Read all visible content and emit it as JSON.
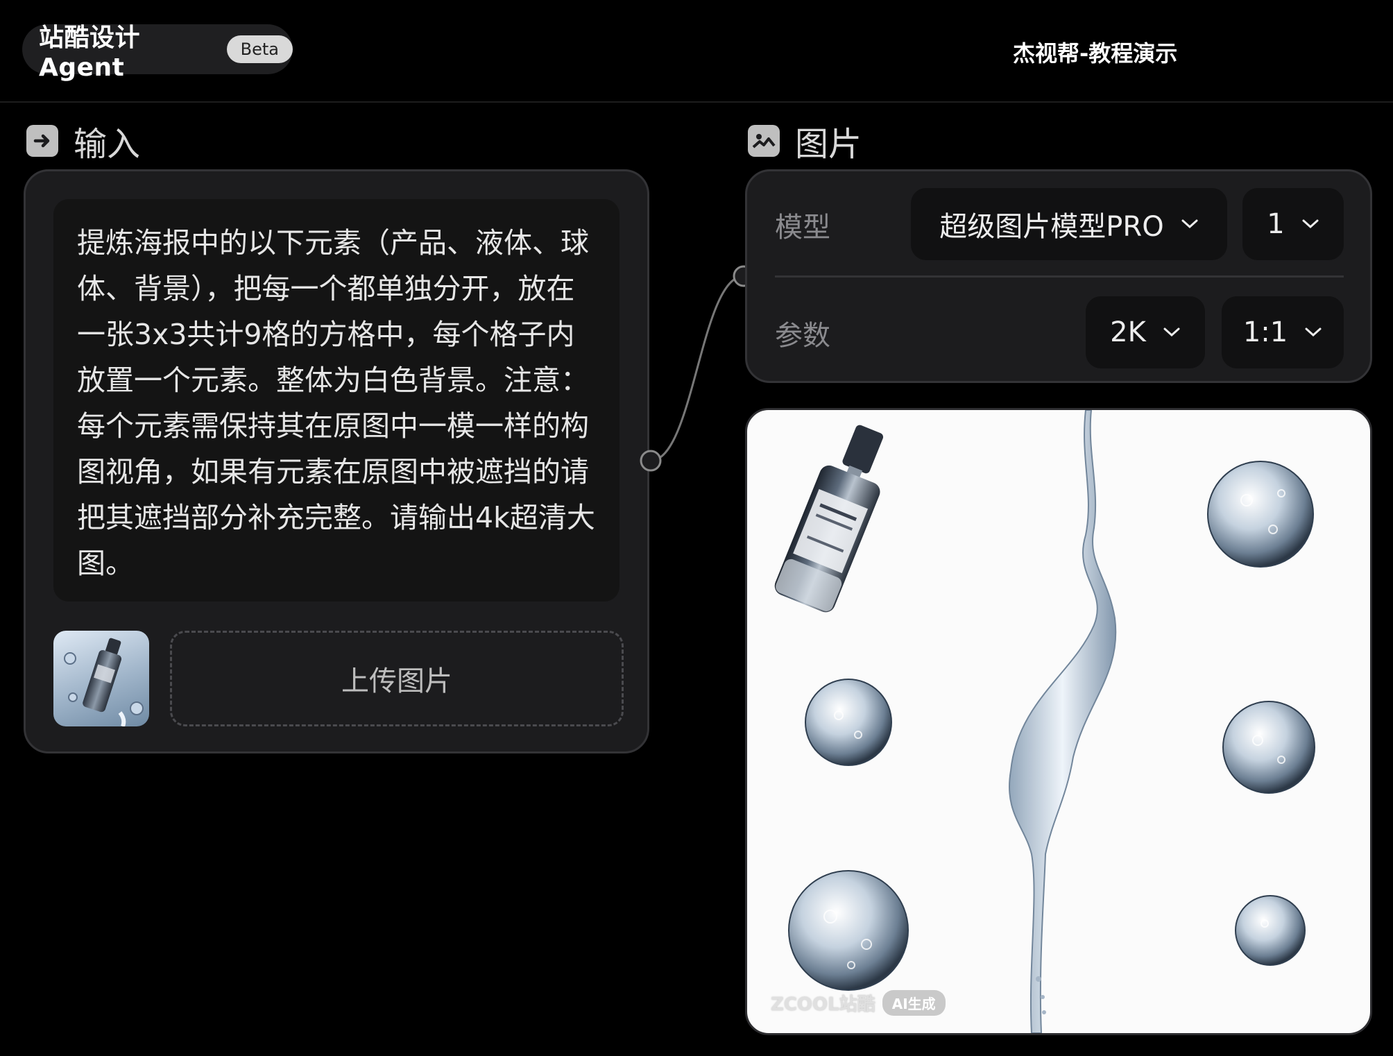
{
  "header": {
    "app_title": "站酷设计Agent",
    "beta_label": "Beta",
    "center_text": "杰视帮-教程演示"
  },
  "input_section": {
    "label": "输入",
    "icon": "arrow-right-icon",
    "prompt_text": "提炼海报中的以下元素（产品、液体、球体、背景），把每一个都单独分开，放在一张3x3共计9格的方格中，每个格子内放置一个元素。整体为白色背景。注意：每个元素需保持其在原图中一模一样的构图视角，如果有元素在原图中被遮挡的请把其遮挡部分补充完整。请输出4k超清大图。",
    "upload_label": "上传图片"
  },
  "image_section": {
    "label": "图片",
    "icon": "image-icon",
    "model_label": "模型",
    "model_value": "超级图片模型PRO",
    "count_value": "1",
    "params_label": "参数",
    "resolution_value": "2K",
    "ratio_value": "1:1"
  },
  "output_image": {
    "watermark_brand": "ZCOOL站酷",
    "watermark_badge": "AI生成"
  },
  "colors": {
    "background": "#000000",
    "card": "#1c1c1e",
    "card_border": "#333336",
    "select_bg": "#111112"
  }
}
